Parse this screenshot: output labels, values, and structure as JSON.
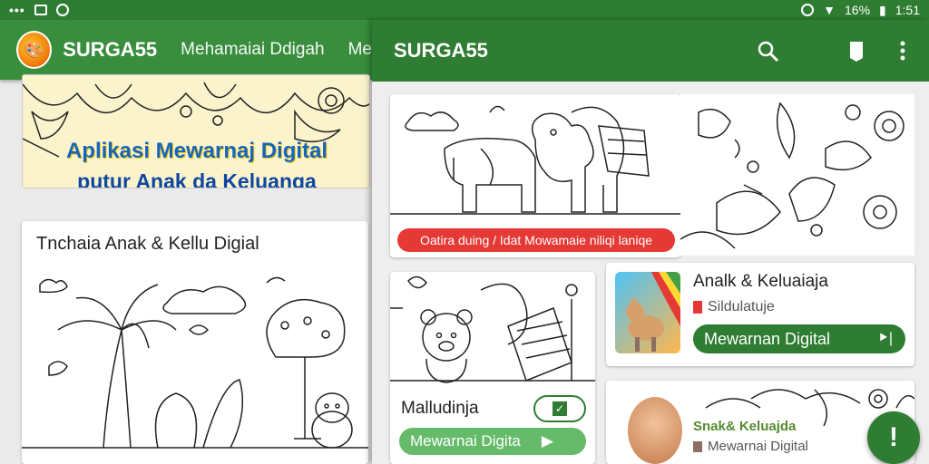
{
  "status": {
    "menu_dots": "•••",
    "battery_text": "16%",
    "time": "1:51"
  },
  "left": {
    "app_title": "SURGA55",
    "tab_active": "Mehamaiai Ddigah",
    "tab_next": "Me",
    "banner": {
      "line1": "Aplikasi Mewarnaj Digital",
      "line2": "putur Anak da Keluanga"
    },
    "card_title": "Tnchaia Anak & Kellu Digial"
  },
  "right": {
    "app_title": "SURGA55",
    "hero_pill": "Oatira duing / Idat Mowamaie niliqi laniqe",
    "bear_card": {
      "title": "Malludinja",
      "button": "Mewarnai Digita"
    },
    "app1": {
      "title": "Analk & Keluaiaja",
      "subtitle": "Sildulatuje",
      "button": "Mewarnan Digital",
      "button_arrow": "⯈|"
    },
    "app2": {
      "title": "Snak& Keluajda",
      "subtitle": "Mewarnai Digital"
    },
    "fab_label": "!"
  },
  "colors": {
    "appbar": "#2e7d32",
    "accent_green": "#66bb6a",
    "pill_red": "#e53935"
  }
}
